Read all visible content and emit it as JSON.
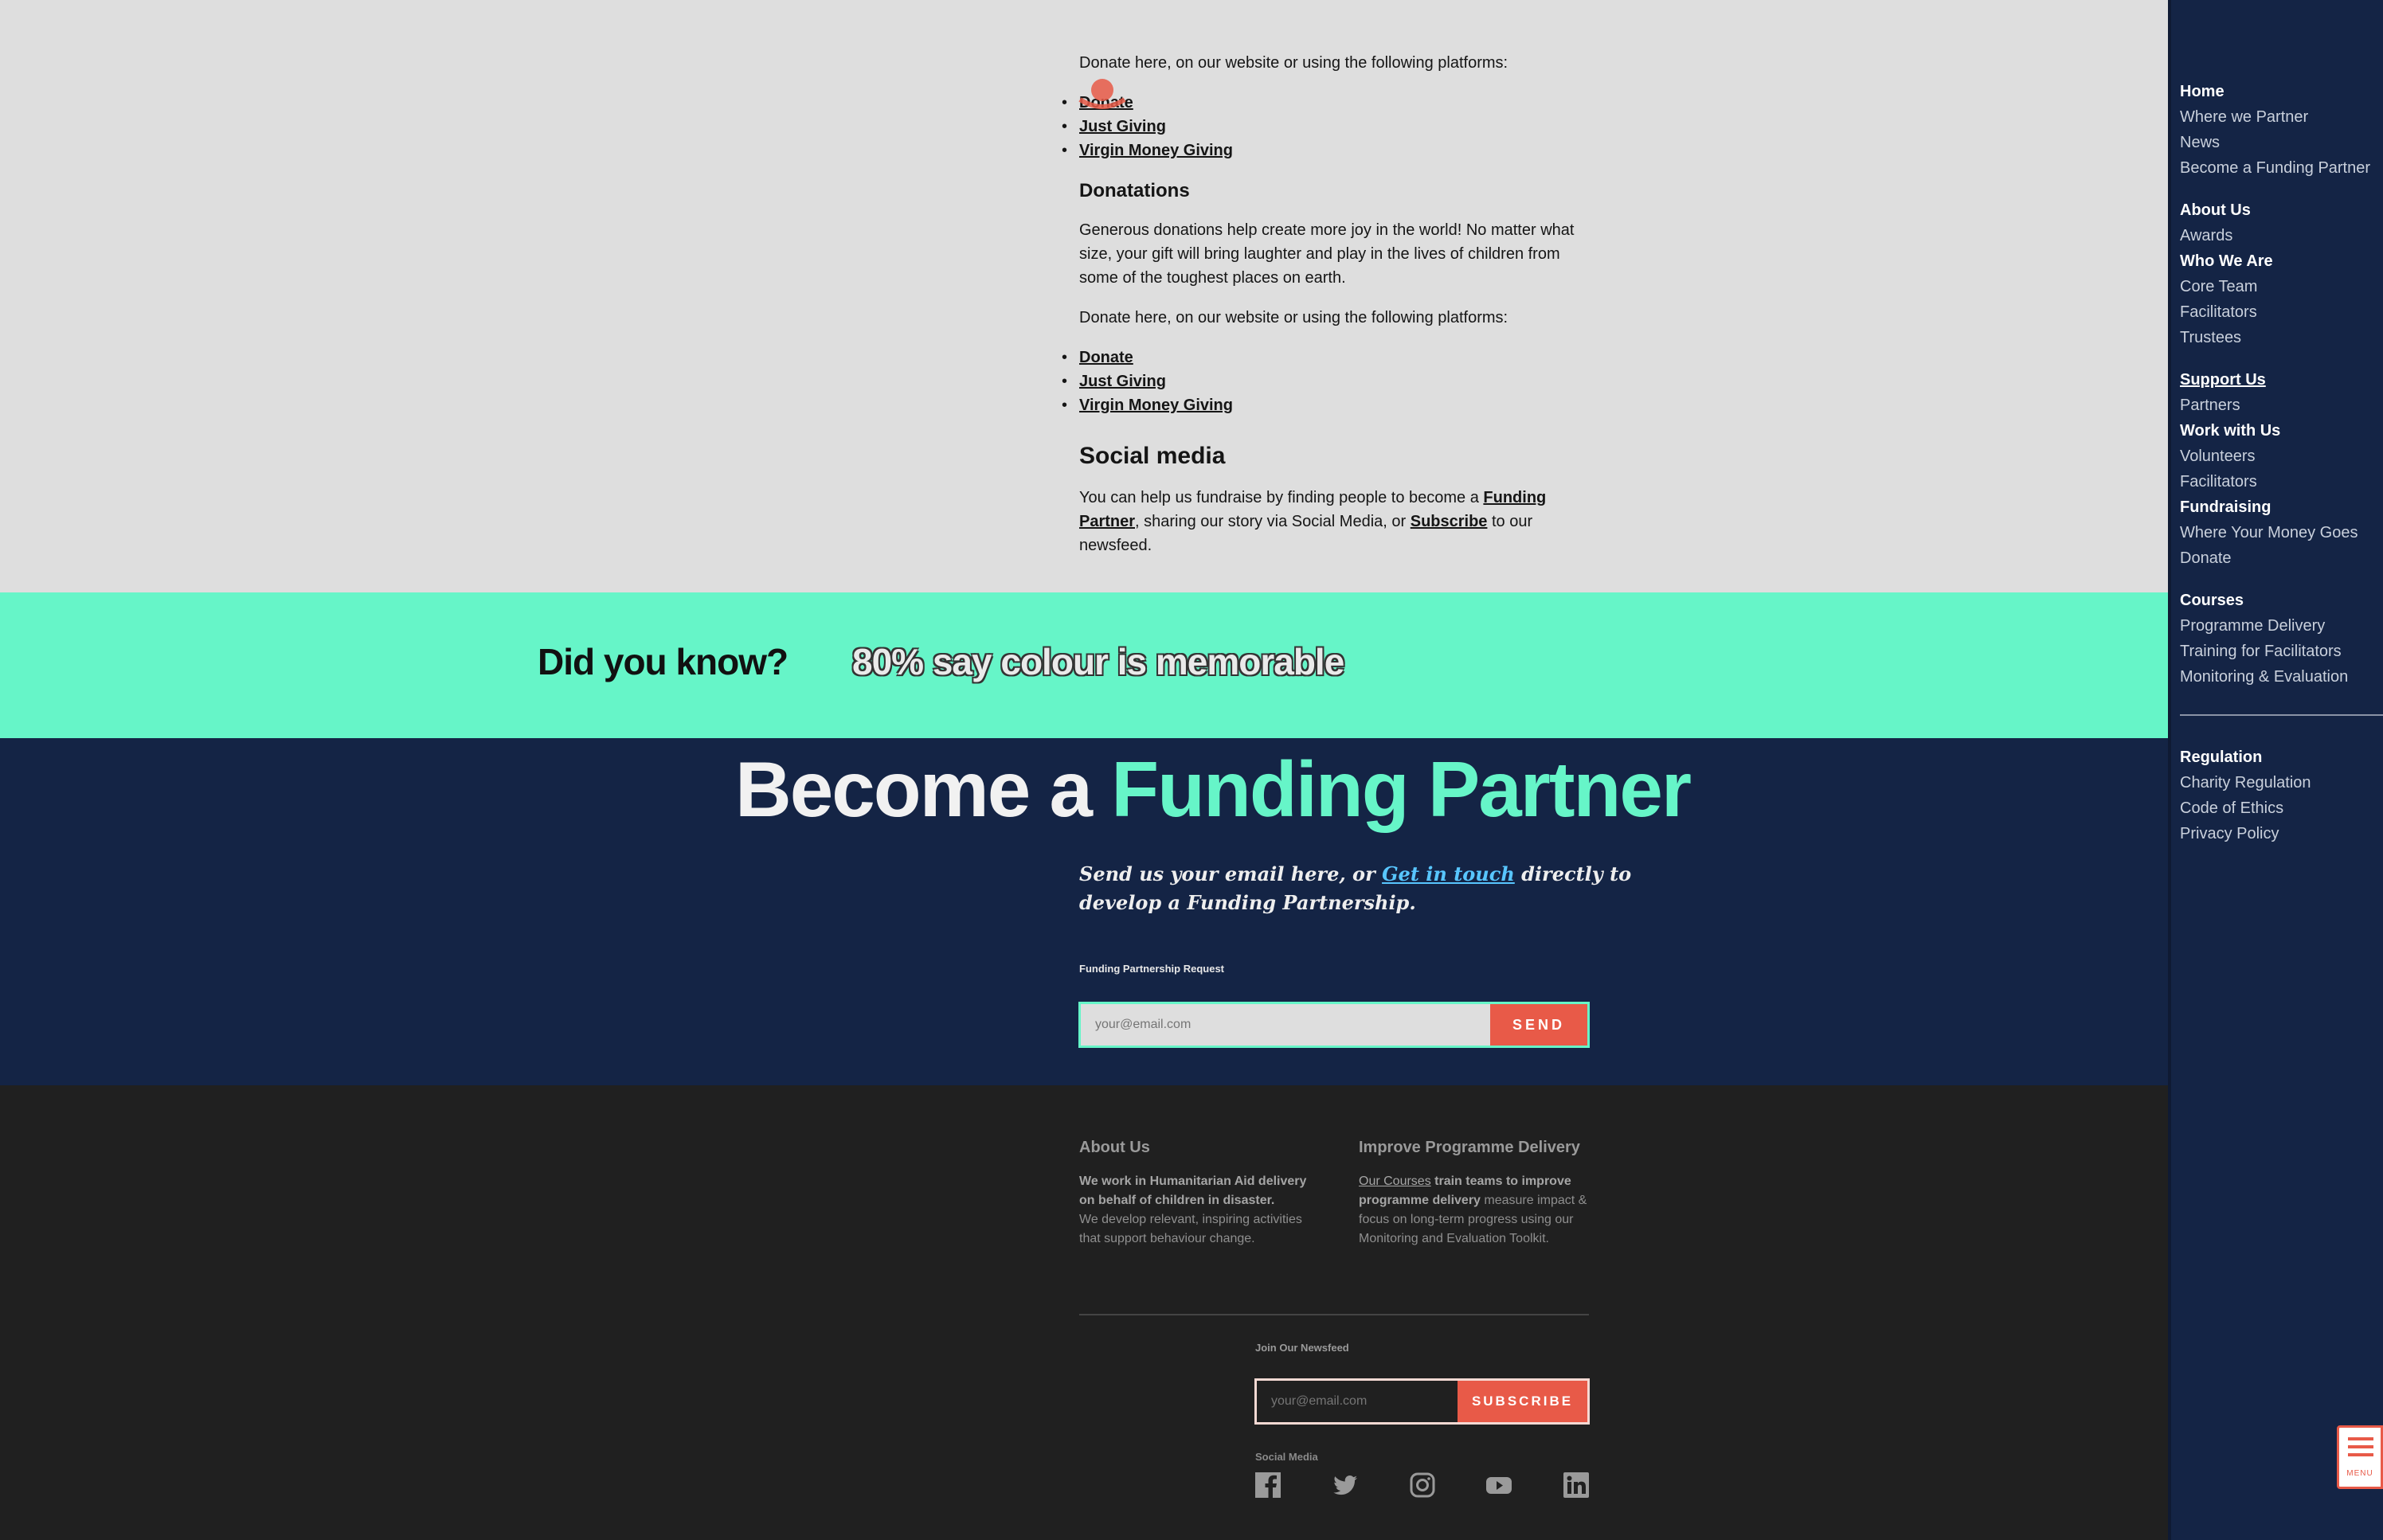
{
  "donate_section_top": {
    "platforms_text": "Donate here, on our website or using the following platforms:",
    "links": [
      "Donate",
      "Just Giving",
      "Virgin Money Giving"
    ]
  },
  "donations": {
    "heading": "Donatations",
    "paragraph": "Generous donations help create more joy in the world! No matter what size, your gift will bring laughter and play in the lives of children from some of the toughest places on earth.",
    "platforms_text": "Donate here, on our website or using the following platforms:",
    "links": [
      "Donate",
      "Just Giving",
      "Virgin Money Giving"
    ]
  },
  "social_media": {
    "heading": "Social media",
    "text_before": "You can help us fundraise by finding people to become a ",
    "funding_partner_link": "Funding Partner",
    "text_middle": ", sharing our story via Social Media, or ",
    "subscribe_link": "Subscribe",
    "text_after": " to our newsfeed."
  },
  "banner": {
    "question": "Did you know?",
    "answer": "80% say colour is memorable",
    "color": "#66f5c8"
  },
  "partner": {
    "title_prefix": "Become a ",
    "title_accent": "Funding Partner",
    "intro_before": "Send us your email here, or ",
    "intro_link": "Get in touch",
    "intro_after": " directly to develop a Funding Partnership.",
    "form_label": "Funding Partnership Request",
    "email_placeholder": "your@email.com",
    "send_label": "SEND"
  },
  "footer": {
    "about": {
      "heading": "About Us",
      "bold_text": "We work in Humanitarian Aid delivery on behalf of children in disaster.",
      "text": "We develop relevant, inspiring activities that support behaviour change."
    },
    "programme": {
      "heading": "Improve Programme Delivery",
      "link": "Our Courses",
      "bold_text": " train teams to improve programme delivery",
      "text": " measure impact & focus on long-term progress using our Monitoring and Evaluation Toolkit."
    },
    "newsfeed_label": "Join Our Newsfeed",
    "newsfeed_placeholder": "your@email.com",
    "subscribe_label": "SUBSCRIBE",
    "social_label": "Social Media",
    "social_icons": [
      "facebook-icon",
      "twitter-icon",
      "instagram-icon",
      "youtube-icon",
      "linkedin-icon"
    ]
  },
  "sidebar": {
    "items": [
      {
        "label": "Home",
        "bold": true
      },
      {
        "label": "Where we Partner"
      },
      {
        "label": "News"
      },
      {
        "label": "Become a Funding Partner"
      },
      {
        "label": "About Us",
        "bold": true
      },
      {
        "label": "Awards"
      },
      {
        "label": "Who We Are",
        "bold": true
      },
      {
        "label": "Core Team"
      },
      {
        "label": "Facilitators"
      },
      {
        "label": "Trustees"
      },
      {
        "label": "Support Us",
        "bold": true,
        "underline": true
      },
      {
        "label": "Partners"
      },
      {
        "label": "Work with Us",
        "bold": true
      },
      {
        "label": "Volunteers"
      },
      {
        "label": "Facilitators"
      },
      {
        "label": "Fundraising",
        "bold": true
      },
      {
        "label": "Where Your Money Goes"
      },
      {
        "label": "Donate"
      },
      {
        "label": "Courses",
        "bold": true
      },
      {
        "label": "Programme Delivery"
      },
      {
        "label": "Training for Facilitators"
      },
      {
        "label": "Monitoring & Evaluation"
      },
      {
        "label": "Regulation",
        "bold": true
      },
      {
        "label": "Charity Regulation"
      },
      {
        "label": "Code of Ethics"
      },
      {
        "label": "Privacy Policy"
      }
    ]
  },
  "menu_button": {
    "label": "MENU"
  },
  "colors": {
    "navy": "#142445",
    "mint": "#66f5c8",
    "coral": "#e85a48",
    "footer_bg": "#202020",
    "page_bg": "#dedede"
  }
}
